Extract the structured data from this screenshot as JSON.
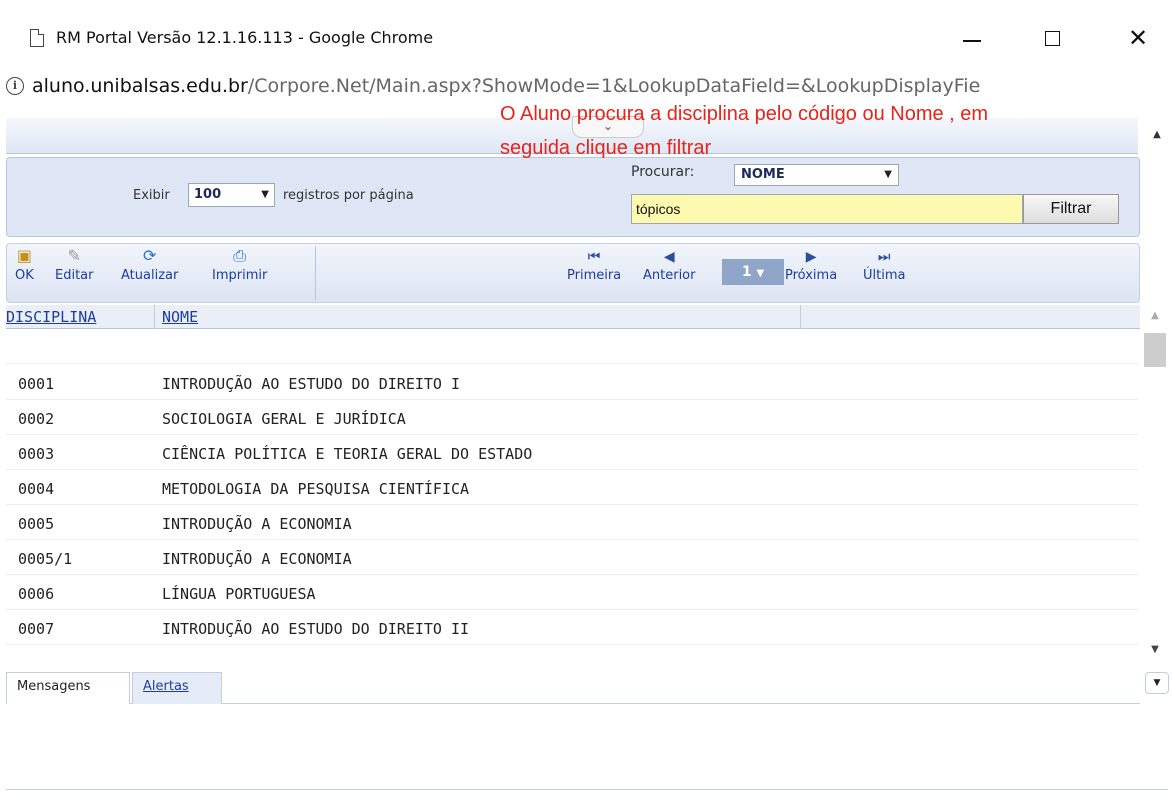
{
  "window": {
    "title": "RM Portal Versão 12.1.16.113 - Google Chrome",
    "close_glyph": "✕"
  },
  "address": {
    "host": "aluno.unibalsas.edu.br",
    "path": "/Corpore.Net/Main.aspx?ShowMode=1&LookupDataField=&LookupDisplayFie"
  },
  "annotation": {
    "line1": "O Aluno procura a disciplina pelo código ou Nome , em",
    "line2": "seguida clique em filtrar",
    "color": "#e8231a"
  },
  "filter": {
    "exibir_label": "Exibir",
    "per_page_value": "100",
    "per_page_suffix": "registros por página",
    "procurar_label": "Procurar:",
    "procurar_value": "NOME",
    "search_value": "tópicos",
    "filter_button": "Filtrar"
  },
  "toolbar": {
    "ok": "OK",
    "editar": "Editar",
    "atualizar": "Atualizar",
    "imprimir": "Imprimir",
    "primeira": "Primeira",
    "anterior": "Anterior",
    "page": "1",
    "proxima": "Próxima",
    "ultima": "Última"
  },
  "grid": {
    "columns": [
      "DISCIPLINA",
      "NOME"
    ],
    "rows": [
      {
        "code": "0001",
        "name": "INTRODUÇÃO AO ESTUDO DO DIREITO I"
      },
      {
        "code": "0002",
        "name": "SOCIOLOGIA GERAL E JURÍDICA"
      },
      {
        "code": "0003",
        "name": "CIÊNCIA POLÍTICA E TEORIA GERAL DO ESTADO"
      },
      {
        "code": "0004",
        "name": "METODOLOGIA DA PESQUISA CIENTÍFICA"
      },
      {
        "code": "0005",
        "name": "INTRODUÇÃO A ECONOMIA"
      },
      {
        "code": "0005/1",
        "name": "INTRODUÇÃO A ECONOMIA"
      },
      {
        "code": "0006",
        "name": "LÍNGUA PORTUGUESA"
      },
      {
        "code": "0007",
        "name": "INTRODUÇÃO AO ESTUDO DO DIREITO II"
      }
    ]
  },
  "tabs": {
    "mensagens": "Mensagens",
    "alertas": "Alertas"
  },
  "colors": {
    "accent_link": "#1c3d9c",
    "panel_bg": "#dfe6f5",
    "search_bg": "#fdfab0"
  }
}
